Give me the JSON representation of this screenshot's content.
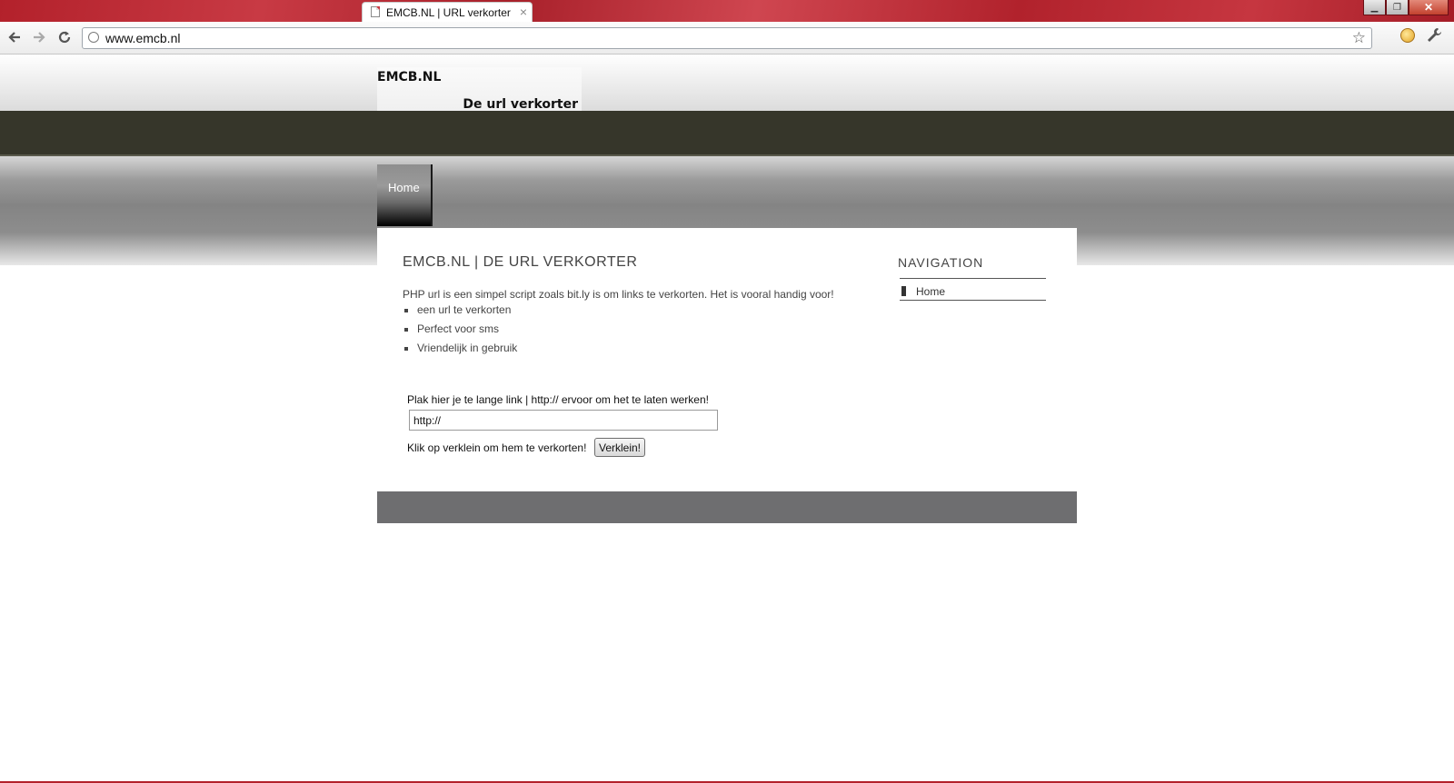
{
  "browser": {
    "tab_title": "EMCB.NL | URL verkorter",
    "address": "www.emcb.nl"
  },
  "site": {
    "logo_title": "EMCB.NL",
    "logo_subtitle": "De url verkorter",
    "nav_tab": "Home"
  },
  "main": {
    "title": "EMCB.NL | DE URL VERKORTER",
    "intro": "PHP url is een simpel script zoals bit.ly is om links te verkorten. Het is vooral handig voor!",
    "features": [
      "een url te verkorten",
      "Perfect voor sms",
      "Vriendelijk in gebruik"
    ],
    "form_label": "Plak hier je te lange link | http:// ervoor om het te laten werken!",
    "url_value": "http://",
    "form_hint": "Klik op verklein om hem te verkorten!",
    "submit_label": "Verklein!"
  },
  "sidebar": {
    "title": "NAVIGATION",
    "items": [
      {
        "label": "Home"
      }
    ]
  },
  "colors": {
    "titlebar": "#b3212b",
    "dark_band": "#36362a",
    "footer": "#6e6e70",
    "text": "#444444"
  }
}
